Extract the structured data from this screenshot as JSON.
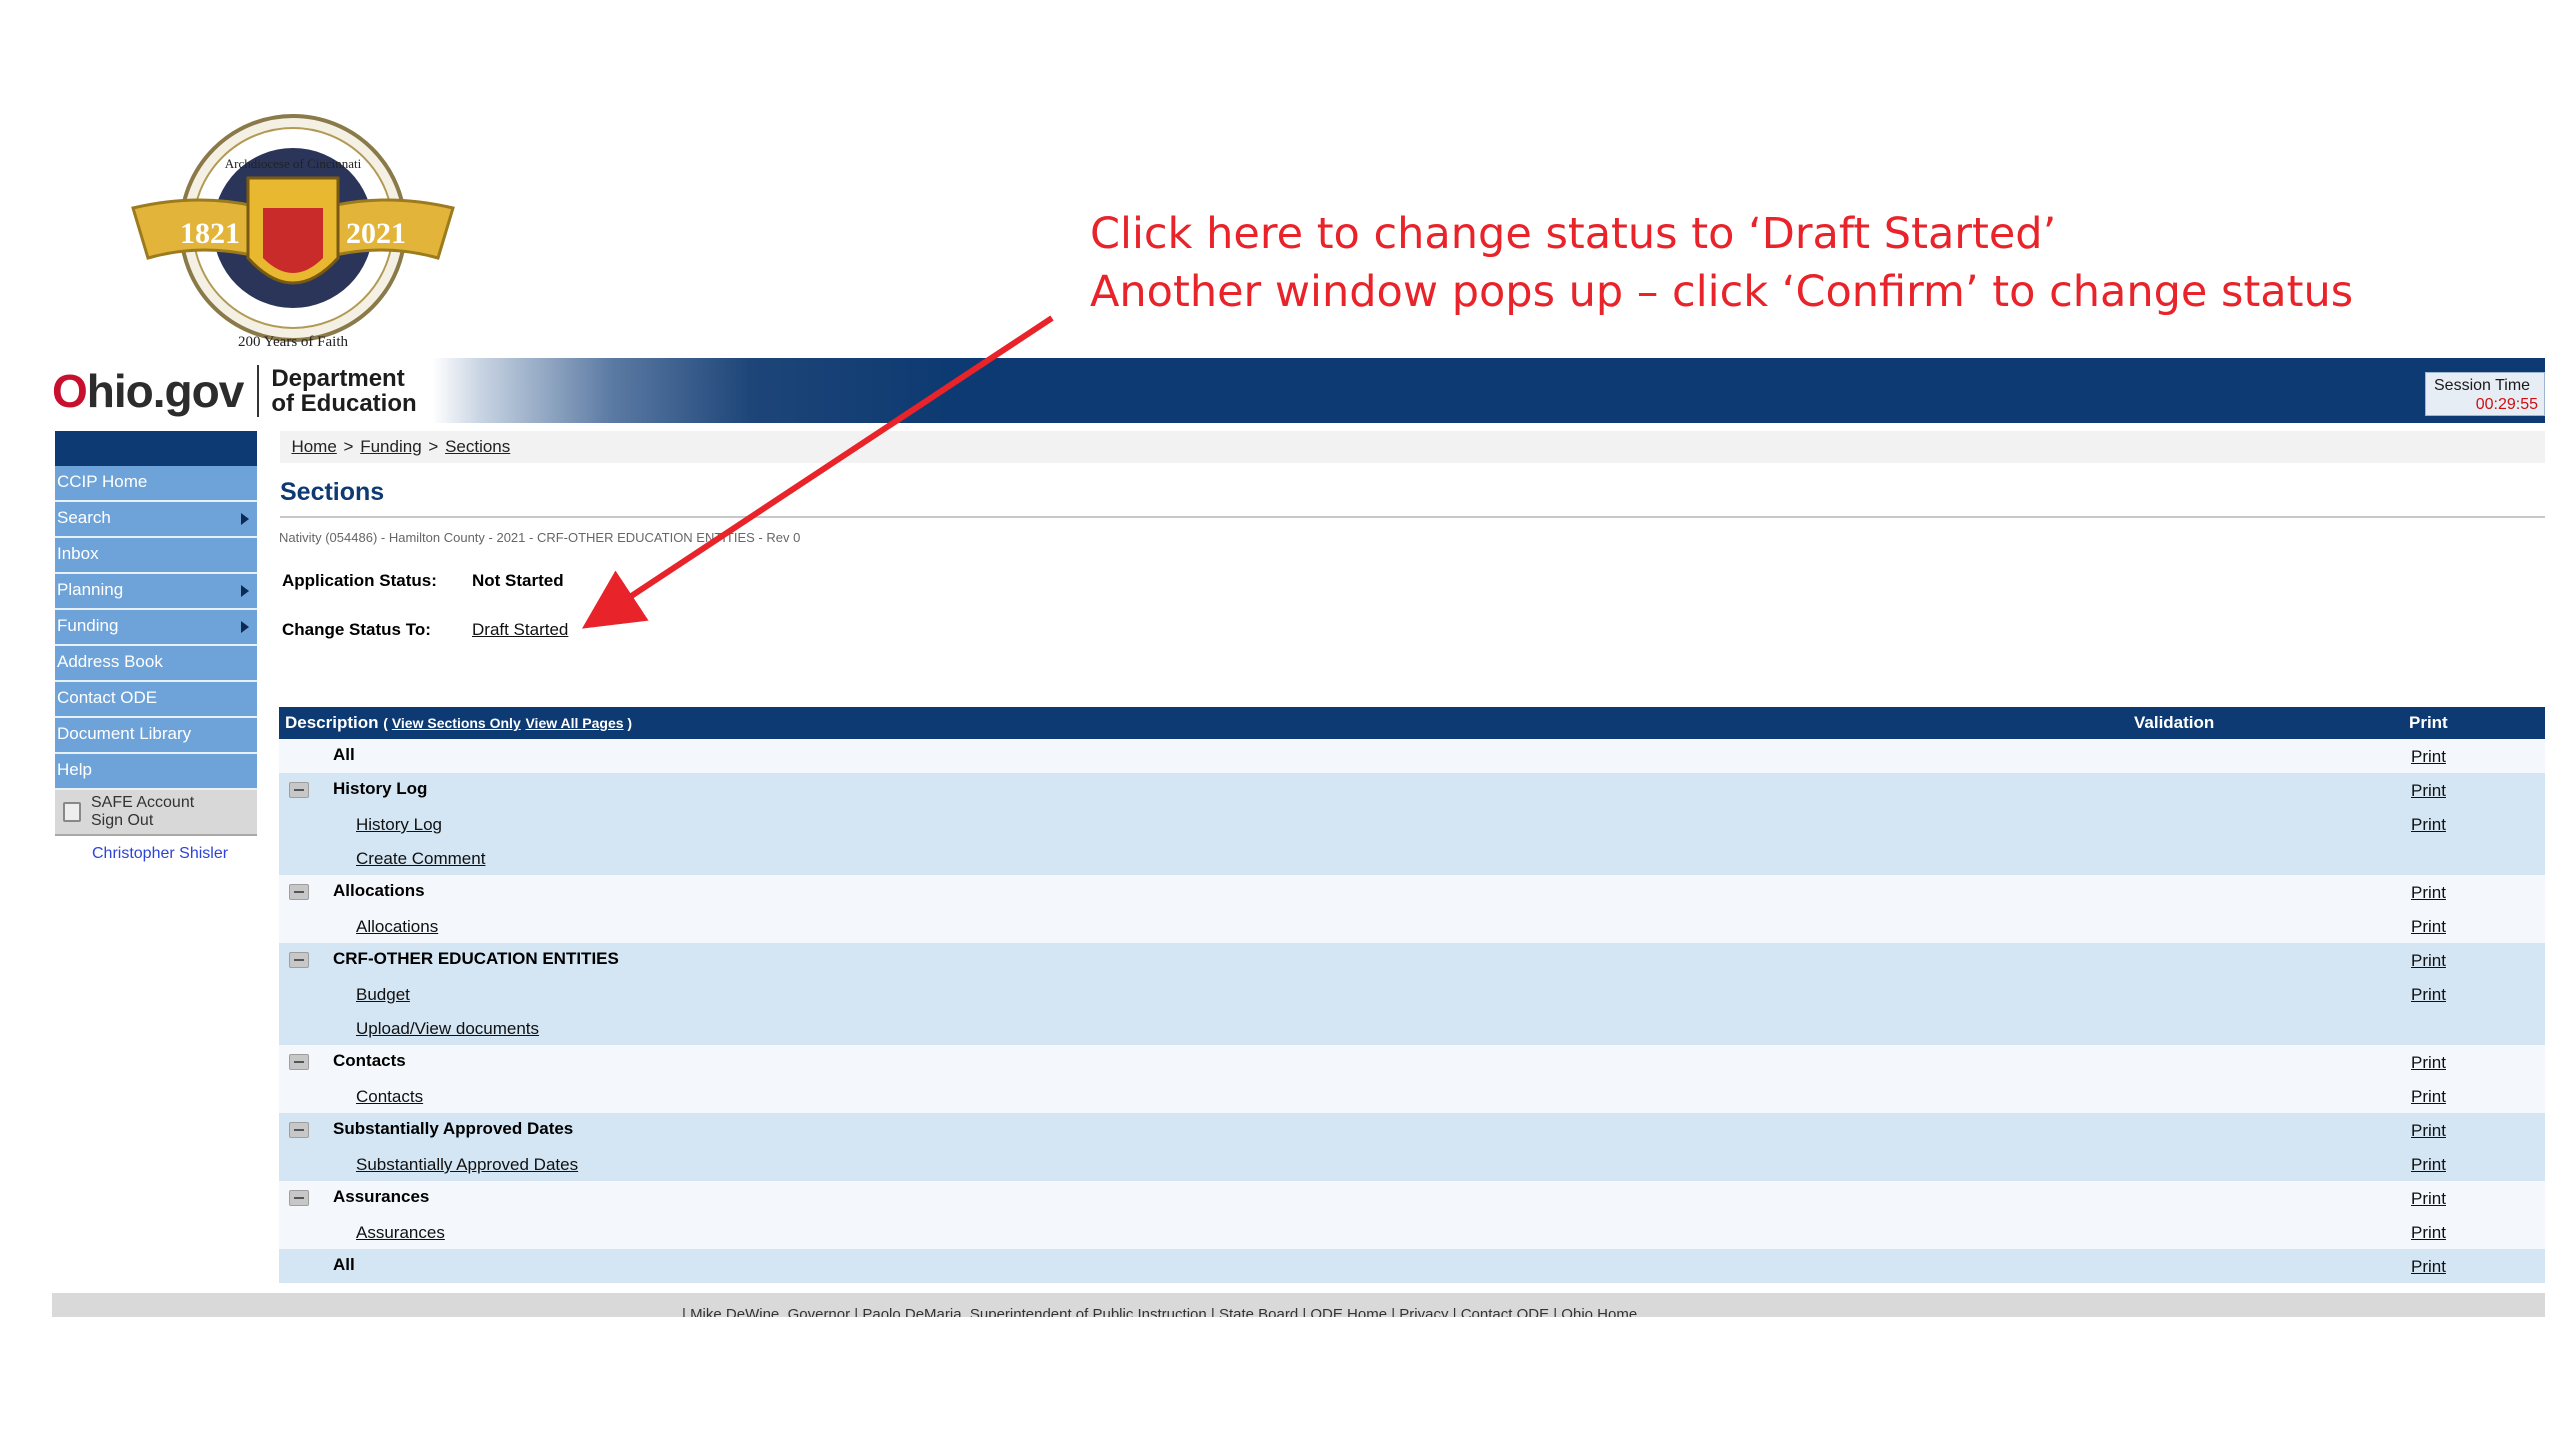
{
  "seal": {
    "circle_text": "Archdiocese of Cincinnati",
    "year_left": "1821",
    "year_right": "2021",
    "bottom_text": "200 Years of Faith"
  },
  "annotation": {
    "line1": "Click here to change status to ‘Draft Started’",
    "line2": "Another window pops up – click ‘Confirm’ to change status",
    "color": "#e8232a"
  },
  "header": {
    "logo_ohio_o": "O",
    "logo_ohio_rest": "hio.gov",
    "dept_line1": "Department",
    "dept_line2": "of Education",
    "session_label": "Session Time",
    "session_time": "00:29:55"
  },
  "nav": {
    "items": [
      {
        "label": "CCIP Home",
        "has_submenu": false
      },
      {
        "label": "Search",
        "has_submenu": true
      },
      {
        "label": "Inbox",
        "has_submenu": false
      },
      {
        "label": "Planning",
        "has_submenu": true
      },
      {
        "label": "Funding",
        "has_submenu": true
      },
      {
        "label": "Address Book",
        "has_submenu": false
      },
      {
        "label": "Contact ODE",
        "has_submenu": false
      },
      {
        "label": "Document Library",
        "has_submenu": false
      },
      {
        "label": "Help",
        "has_submenu": false
      }
    ],
    "safe_line1": "SAFE Account",
    "safe_line2": "Sign Out",
    "user_name": "Christopher Shisler"
  },
  "breadcrumb": {
    "home": "Home",
    "sep": ">",
    "funding": "Funding",
    "sections": "Sections"
  },
  "page": {
    "title": "Sections",
    "subinfo": "Nativity (054486) - Hamilton County - 2021 - CRF-OTHER EDUCATION ENTITIES - Rev 0",
    "app_status_label": "Application Status:",
    "app_status_value": "Not Started",
    "change_status_label": "Change Status To:",
    "change_status_link": "Draft Started"
  },
  "table": {
    "col_description": "Description",
    "view_sections_only": "View Sections Only",
    "view_all_pages": "View All Pages",
    "col_validation": "Validation",
    "col_print": "Print",
    "print_label": "Print",
    "all_label": "All",
    "groups": [
      {
        "title": "History Log",
        "items": [
          "History Log",
          "Create Comment"
        ],
        "item_print": [
          true,
          false
        ]
      },
      {
        "title": "Allocations",
        "items": [
          "Allocations"
        ],
        "item_print": [
          true
        ]
      },
      {
        "title": "CRF-OTHER EDUCATION ENTITIES",
        "items": [
          "Budget",
          "Upload/View documents"
        ],
        "item_print": [
          true,
          false
        ]
      },
      {
        "title": "Contacts",
        "items": [
          "Contacts"
        ],
        "item_print": [
          true
        ]
      },
      {
        "title": "Substantially Approved Dates",
        "items": [
          "Substantially Approved Dates"
        ],
        "item_print": [
          true
        ]
      },
      {
        "title": "Assurances",
        "items": [
          "Assurances"
        ],
        "item_print": [
          true
        ]
      }
    ]
  },
  "footer": {
    "links": "| Mike DeWine, Governor | Paolo DeMaria, Superintendent of Public Instruction | State Board | ODE Home | Privacy | Contact ODE | Ohio Home"
  }
}
